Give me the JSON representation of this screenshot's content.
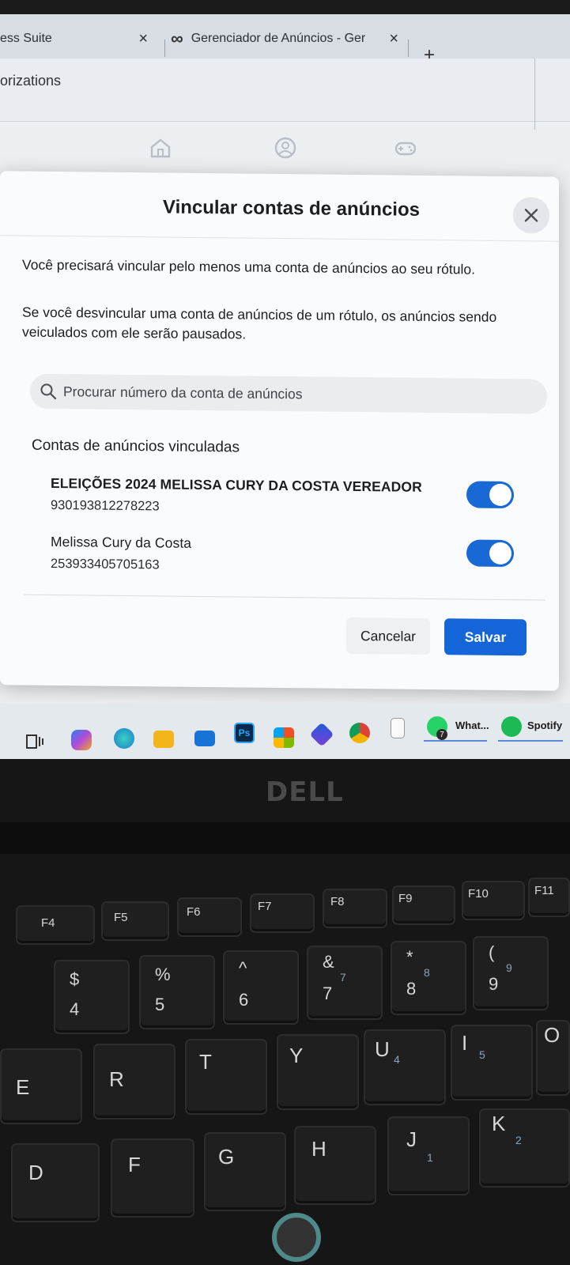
{
  "browser": {
    "tabs": [
      {
        "title": "ess Suite",
        "close": "×"
      },
      {
        "title": "Gerenciador de Anúncios - Ger",
        "close": "×",
        "icon": "meta-infinity-icon"
      }
    ],
    "new_tab": "+",
    "page_crumb": "orizations"
  },
  "modal": {
    "title": "Vincular contas de anúncios",
    "intro_1": "Você precisará vincular pelo menos uma conta de anúncios ao seu rótulo.",
    "intro_2": "Se você desvincular uma conta de anúncios de um rótulo, os anúncios sendo veiculados com ele serão pausados.",
    "search_placeholder": "Procurar número da conta de anúncios",
    "linked_heading": "Contas de anúncios vinculadas",
    "accounts": [
      {
        "name": "ELEIÇÕES 2024 MELISSA CURY DA COSTA VEREADOR",
        "id": "930193812278223",
        "enabled": true
      },
      {
        "name": "Melissa Cury da Costa",
        "id": "253933405705163",
        "enabled": true
      }
    ],
    "cancel_label": "Cancelar",
    "save_label": "Salvar",
    "colors": {
      "primary": "#1466d8",
      "toggle": "#1868d6"
    }
  },
  "taskbar": {
    "whatsapp_label": "What...",
    "whatsapp_badge": "7",
    "spotify_label": "Spotify",
    "ps_label": "Ps"
  },
  "laptop": {
    "brand": "DELL",
    "fkeys": [
      "F4",
      "F5",
      "F6",
      "F7",
      "F8",
      "F9",
      "F10",
      "F11"
    ],
    "number_keys": [
      {
        "top": "$",
        "main": "4"
      },
      {
        "top": "%",
        "main": "5"
      },
      {
        "top": "^",
        "main": "6"
      },
      {
        "top": "&",
        "main": "7",
        "sub": "7"
      },
      {
        "top": "*",
        "main": "8",
        "sub": "8"
      },
      {
        "top": "(",
        "main": "9",
        "sub": "9"
      }
    ],
    "letter_row_1": [
      {
        "main": "E"
      },
      {
        "main": "R"
      },
      {
        "main": "T"
      },
      {
        "main": "Y"
      },
      {
        "main": "U",
        "sub": "4"
      },
      {
        "main": "I",
        "sub": "5"
      },
      {
        "main": "O"
      }
    ],
    "letter_row_2": [
      {
        "main": "D"
      },
      {
        "main": "F"
      },
      {
        "main": "G"
      },
      {
        "main": "H"
      },
      {
        "main": "J",
        "sub": "1"
      },
      {
        "main": "K",
        "sub": "2"
      }
    ]
  }
}
